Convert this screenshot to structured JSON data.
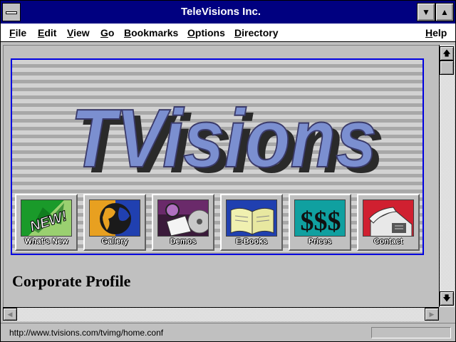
{
  "window": {
    "title": "TeleVisions Inc."
  },
  "menubar": {
    "items": [
      "File",
      "Edit",
      "View",
      "Go",
      "Bookmarks",
      "Options",
      "Directory"
    ],
    "help": "Help"
  },
  "banner": {
    "logo_text": "TVisions",
    "buttons": [
      {
        "label": "What's New",
        "icon": "new-burst-icon",
        "art_text": "NEW!"
      },
      {
        "label": "Gallery",
        "icon": "globe-icon"
      },
      {
        "label": "Demos",
        "icon": "camera-disc-icon"
      },
      {
        "label": "E-Books",
        "icon": "open-book-icon"
      },
      {
        "label": "Prices",
        "icon": "dollar-signs-icon",
        "art_text": "$$$"
      },
      {
        "label": "Contact",
        "icon": "telephone-icon"
      }
    ]
  },
  "page": {
    "heading": "Corporate Profile"
  },
  "status": {
    "url": "http://www.tvisions.com/tvimg/home.conf"
  },
  "colors": {
    "titlebar": "#000080",
    "window": "#c0c0c0",
    "logo_fill": "#7b8fd0",
    "banner_border": "#0000e0"
  }
}
